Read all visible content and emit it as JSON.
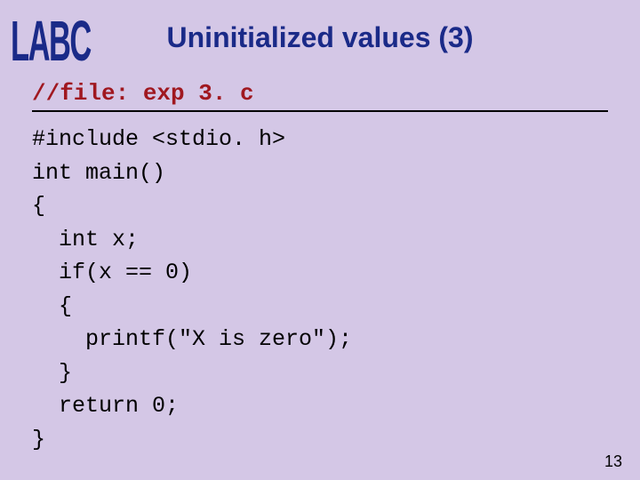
{
  "logo": "LABC",
  "title": "Uninitialized values (3)",
  "file_comment": "//file: exp 3. c",
  "code_lines": {
    "l0": "#include <stdio. h>",
    "l1": "int main()",
    "l2": "{",
    "l3": "  int x;",
    "l4": "  if(x == 0)",
    "l5": "  {",
    "l6": "    printf(\"X is zero\");",
    "l7": "  }",
    "l8": "  return 0;",
    "l9": "}"
  },
  "page_number": "13"
}
